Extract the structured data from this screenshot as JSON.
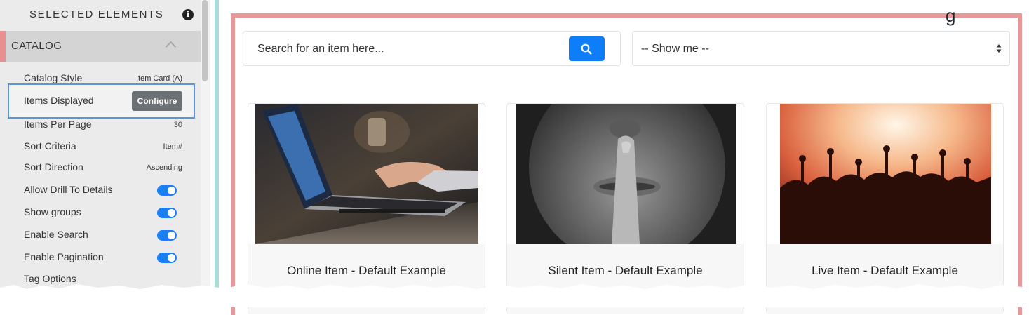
{
  "sidebar": {
    "header": "SELECTED ELEMENTS",
    "section": "CATALOG",
    "rows": {
      "catalog_style": {
        "label": "Catalog Style",
        "value": "Item Card (A)"
      },
      "items_displayed": {
        "label": "Items Displayed",
        "button": "Configure"
      },
      "items_per_page": {
        "label": "Items Per Page",
        "value": "30"
      },
      "sort_criteria": {
        "label": "Sort Criteria",
        "value": "Item#"
      },
      "sort_direction": {
        "label": "Sort Direction",
        "value": "Ascending"
      },
      "allow_drill": {
        "label": "Allow Drill To Details",
        "on": true
      },
      "show_groups": {
        "label": "Show groups",
        "on": true
      },
      "enable_search": {
        "label": "Enable Search",
        "on": true
      },
      "enable_pagination": {
        "label": "Enable Pagination",
        "on": true
      },
      "tag_options": {
        "label": "Tag Options"
      }
    }
  },
  "main": {
    "search_placeholder": "Search for an item here...",
    "filter_selected": "-- Show me --",
    "cards": [
      {
        "title": "Online Item - Default Example",
        "image": "laptop-typing-photo"
      },
      {
        "title": "Silent Item - Default Example",
        "image": "finger-on-lips-photo"
      },
      {
        "title": "Live Item - Default Example",
        "image": "concert-crowd-photo"
      }
    ]
  },
  "colors": {
    "accent_blue": "#0d7ef7",
    "frame_red": "#e89898",
    "divider_teal": "#a9ded8",
    "configure_gray": "#6c7176"
  }
}
